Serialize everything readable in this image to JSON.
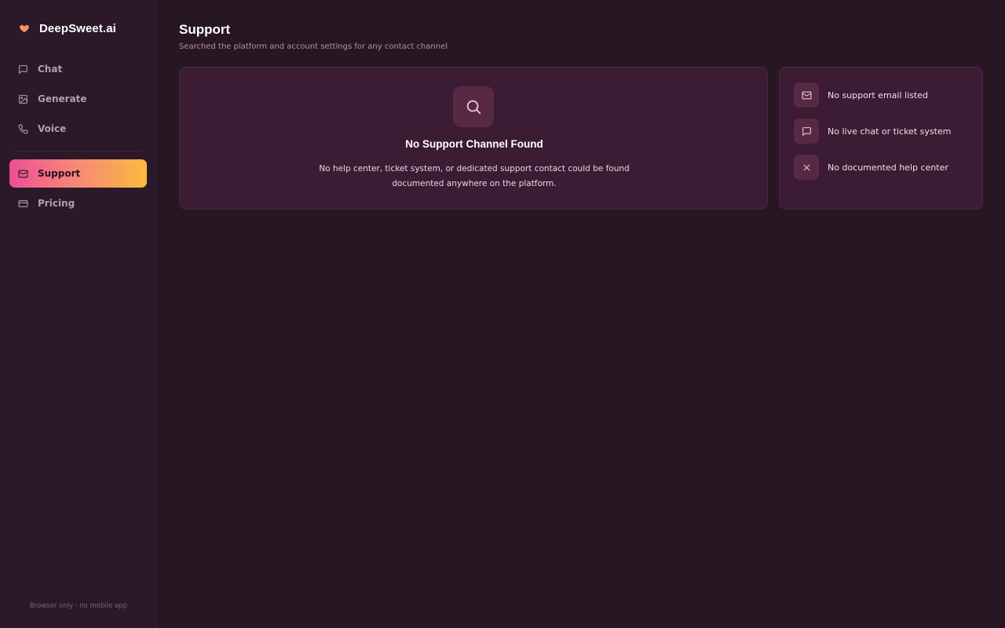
{
  "app": {
    "name": "DeepSweet.ai",
    "logo_icon": "heart-icon",
    "accent_colors": [
      "#ec4f95",
      "#f6857a",
      "#fbba3e"
    ]
  },
  "sidebar": {
    "items": [
      {
        "label": "Chat",
        "icon": "message-square-icon",
        "active": false
      },
      {
        "label": "Generate",
        "icon": "image-icon",
        "active": false
      },
      {
        "label": "Voice",
        "icon": "phone-icon",
        "active": false
      },
      {
        "label": "Support",
        "icon": "mail-icon",
        "active": true
      },
      {
        "label": "Pricing",
        "icon": "credit-card-icon",
        "active": false
      }
    ],
    "footer": "Browser only · no mobile app"
  },
  "page": {
    "title": "Support",
    "subtitle": "Searched the platform and account settings for any contact channel"
  },
  "main_card": {
    "icon": "search-icon",
    "title": "No Support Channel Found",
    "description": "No help center, ticket system, or dedicated support contact could be found documented anywhere on the platform."
  },
  "side_card": {
    "items": [
      {
        "label": "No support email listed",
        "icon": "mail-icon"
      },
      {
        "label": "No live chat or ticket system",
        "icon": "message-square-icon"
      },
      {
        "label": "No documented help center",
        "icon": "x-icon"
      }
    ]
  }
}
